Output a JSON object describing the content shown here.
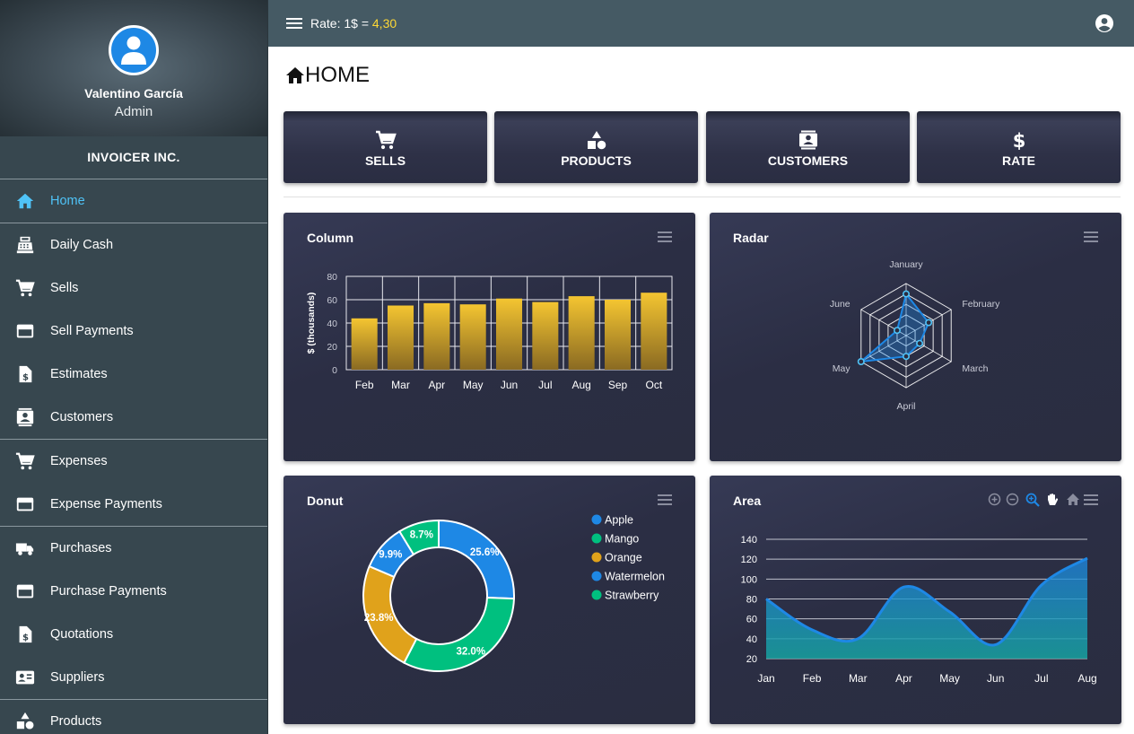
{
  "user": {
    "name": "Valentino García",
    "role": "Admin"
  },
  "company": "INVOICER INC.",
  "nav_groups": [
    [
      {
        "label": "Home",
        "icon": "home-icon",
        "active": true
      }
    ],
    [
      {
        "label": "Daily Cash",
        "icon": "cash-register-icon"
      },
      {
        "label": "Sells",
        "icon": "cart-icon"
      },
      {
        "label": "Sell Payments",
        "icon": "credit-card-icon"
      },
      {
        "label": "Estimates",
        "icon": "dollar-file-icon"
      },
      {
        "label": "Customers",
        "icon": "contacts-icon"
      }
    ],
    [
      {
        "label": "Expenses",
        "icon": "cart-icon"
      },
      {
        "label": "Expense Payments",
        "icon": "credit-card-icon"
      }
    ],
    [
      {
        "label": "Purchases",
        "icon": "truck-icon"
      },
      {
        "label": "Purchase Payments",
        "icon": "credit-card-icon"
      },
      {
        "label": "Quotations",
        "icon": "dollar-file-icon"
      },
      {
        "label": "Suppliers",
        "icon": "card-account-icon"
      }
    ],
    [
      {
        "label": "Products",
        "icon": "shapes-icon"
      }
    ]
  ],
  "topbar": {
    "rate_label": "Rate: 1$ = ",
    "rate_value": "4,30"
  },
  "page_title": "HOME",
  "quick_actions": [
    {
      "label": "SELLS",
      "icon": "cart-icon"
    },
    {
      "label": "PRODUCTS",
      "icon": "shapes-icon"
    },
    {
      "label": "CUSTOMERS",
      "icon": "contacts-icon"
    },
    {
      "label": "RATE",
      "icon": "dollar-icon"
    }
  ],
  "colors": {
    "accent": "#4fc3f7",
    "rate": "#fdd835",
    "bar": "#f2c12e",
    "blue": "#1e88e5",
    "green": "#00c07f",
    "orange": "#e0a21b"
  },
  "chart_data": [
    {
      "type": "bar",
      "title": "Column",
      "categories": [
        "Feb",
        "Mar",
        "Apr",
        "May",
        "Jun",
        "Jul",
        "Aug",
        "Sep",
        "Oct"
      ],
      "values": [
        44,
        55,
        57,
        56,
        61,
        58,
        63,
        60,
        66
      ],
      "ylabel": "$ (thousands)",
      "ylim": [
        0,
        80
      ],
      "yticks": [
        0,
        20,
        40,
        60,
        80
      ],
      "grid": true
    },
    {
      "type": "radar",
      "title": "Radar",
      "categories": [
        "January",
        "February",
        "March",
        "April",
        "May",
        "June"
      ],
      "values": [
        80,
        50,
        30,
        40,
        100,
        20
      ],
      "max": 100
    },
    {
      "type": "pie",
      "title": "Donut",
      "labels": [
        "Apple",
        "Mango",
        "Orange",
        "Watermelon",
        "Strawberry"
      ],
      "values": [
        25.6,
        32.0,
        23.8,
        9.9,
        8.7
      ],
      "value_labels": [
        "25.6%",
        "32.0%",
        "23.8%",
        "9.9%",
        "8.7%"
      ],
      "colors": [
        "#1e88e5",
        "#00c07f",
        "#e0a21b",
        "#1e88e5",
        "#00c07f"
      ],
      "legend": "top-right"
    },
    {
      "type": "area",
      "title": "Area",
      "categories": [
        "Jan",
        "Feb",
        "Mar",
        "Apr",
        "May",
        "Jun",
        "Jul",
        "Aug"
      ],
      "values": [
        80,
        49,
        40,
        92,
        67,
        34,
        94,
        121
      ],
      "ylim": [
        20,
        140
      ],
      "yticks": [
        20,
        40,
        60,
        80,
        100,
        120,
        140
      ],
      "grid": true,
      "toolbar": [
        "zoom-in-icon",
        "zoom-out-icon",
        "zoom-select-icon",
        "pan-hand-icon",
        "reset-home-icon",
        "menu-icon"
      ]
    }
  ]
}
